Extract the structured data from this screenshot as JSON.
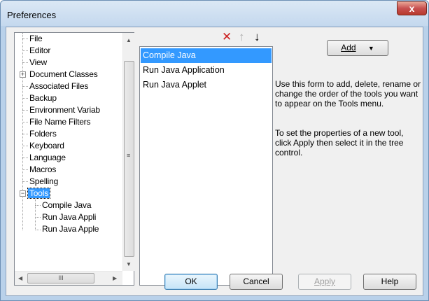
{
  "window": {
    "title": "Preferences",
    "close_label": "x"
  },
  "tree": {
    "items": [
      {
        "label": "File"
      },
      {
        "label": "Editor"
      },
      {
        "label": "View"
      },
      {
        "label": "Document Classes"
      },
      {
        "label": "Associated Files"
      },
      {
        "label": "Backup"
      },
      {
        "label": "Environment Variab"
      },
      {
        "label": "File Name Filters"
      },
      {
        "label": "Folders"
      },
      {
        "label": "Keyboard"
      },
      {
        "label": "Language"
      },
      {
        "label": "Macros"
      },
      {
        "label": "Spelling"
      },
      {
        "label": "Tools"
      }
    ],
    "children": [
      {
        "label": "Compile Java"
      },
      {
        "label": "Run Java Appli"
      },
      {
        "label": "Run Java Apple"
      }
    ],
    "expander_plus": "+",
    "expander_minus": "−",
    "hscroll_thumb": "III"
  },
  "toolbar": {
    "delete_icon": "delete-icon",
    "up_icon": "move-up-icon",
    "down_icon": "move-down-icon",
    "delete_glyph": "✕",
    "up_glyph": "↑",
    "down_glyph": "↓"
  },
  "tools_list": {
    "items": [
      "Compile Java",
      "Run Java Application",
      "Run Java Applet"
    ],
    "selected_index": 0
  },
  "add_button": {
    "label": "Add",
    "arrow": "▼"
  },
  "description": {
    "para1": "Use this form to add, delete, rename or change the order of the tools you want to appear on the Tools menu.",
    "para2": "To set the properties of a new tool, click Apply then select it in the tree control."
  },
  "buttons": {
    "ok": "OK",
    "cancel": "Cancel",
    "apply": "Apply",
    "help": "Help"
  },
  "colors": {
    "selection": "#3399ff",
    "delete_icon": "#cc2222"
  }
}
